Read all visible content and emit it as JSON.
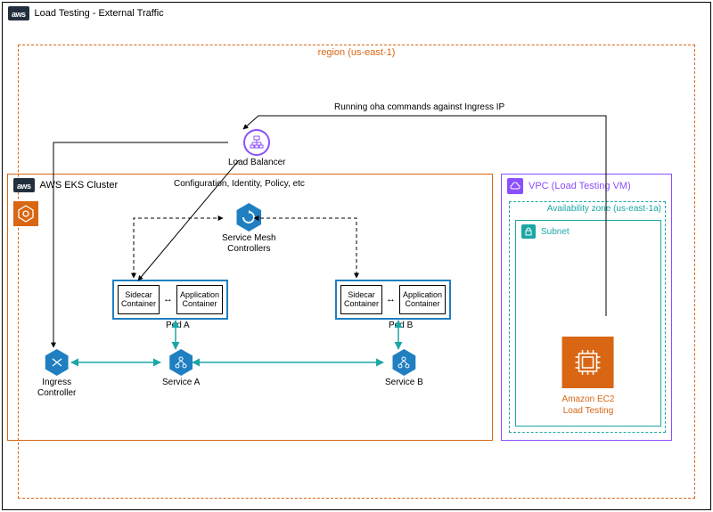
{
  "title": "Load Testing - External Traffic",
  "region": {
    "label": "region (us-east-1)"
  },
  "eks": {
    "label": "AWS EKS Cluster",
    "config_text": "Configuration, Identity, Policy, etc"
  },
  "lb": {
    "label": "Load Balancer"
  },
  "smc": {
    "label": "Service Mesh\nControllers"
  },
  "pods": {
    "a": {
      "label": "Pod A",
      "sidecar": "Sidecar\nContainer",
      "app": "Application\nContainer"
    },
    "b": {
      "label": "Pod B",
      "sidecar": "Sidecar\nContainer",
      "app": "Application\nContainer"
    }
  },
  "services": {
    "a": "Service A",
    "b": "Service B"
  },
  "ingress": {
    "label": "Ingress\nController"
  },
  "vpc": {
    "label": "VPC (Load Testing VM)"
  },
  "az": {
    "label": "Availability zone (us-east-1a)"
  },
  "subnet": {
    "label": "Subnet"
  },
  "ec2": {
    "label": "Amazon EC2\nLoad Testing"
  },
  "oha_text": "Running oha commands against Ingress IP",
  "colors": {
    "orange": "#d86613",
    "purple": "#8c4fff",
    "teal": "#1ba6a6",
    "blue": "#1f7fc1"
  }
}
